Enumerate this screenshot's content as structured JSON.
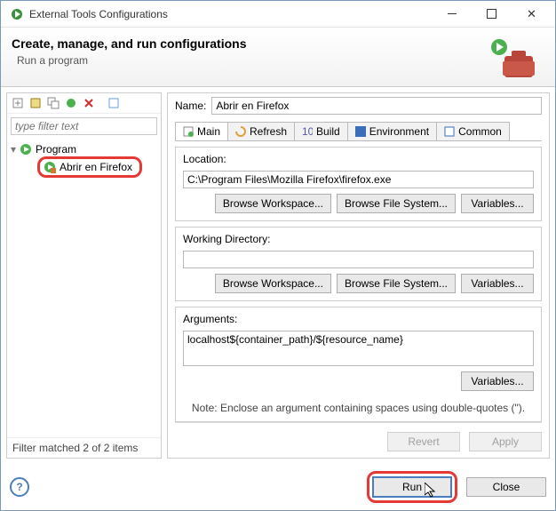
{
  "window": {
    "title": "External Tools Configurations"
  },
  "header": {
    "title": "Create, manage, and run configurations",
    "subtitle": "Run a program"
  },
  "left": {
    "filter_placeholder": "type filter text",
    "root_label": "Program",
    "child_label": "Abrir en Firefox",
    "status": "Filter matched 2 of 2 items"
  },
  "form": {
    "name_label": "Name:",
    "name_value": "Abrir en Firefox",
    "tabs": {
      "main": "Main",
      "refresh": "Refresh",
      "build": "Build",
      "environment": "Environment",
      "common": "Common"
    },
    "location": {
      "label": "Location:",
      "value": "C:\\Program Files\\Mozilla Firefox\\firefox.exe",
      "browse_ws": "Browse Workspace...",
      "browse_fs": "Browse File System...",
      "variables": "Variables..."
    },
    "working_dir": {
      "label": "Working Directory:",
      "value": "",
      "browse_ws": "Browse Workspace...",
      "browse_fs": "Browse File System...",
      "variables": "Variables..."
    },
    "arguments": {
      "label": "Arguments:",
      "value": "localhost${container_path}/${resource_name}",
      "variables": "Variables...",
      "note": "Note: Enclose an argument containing spaces using double-quotes (\")."
    },
    "revert": "Revert",
    "apply": "Apply"
  },
  "footer": {
    "run": "Run",
    "close": "Close"
  }
}
